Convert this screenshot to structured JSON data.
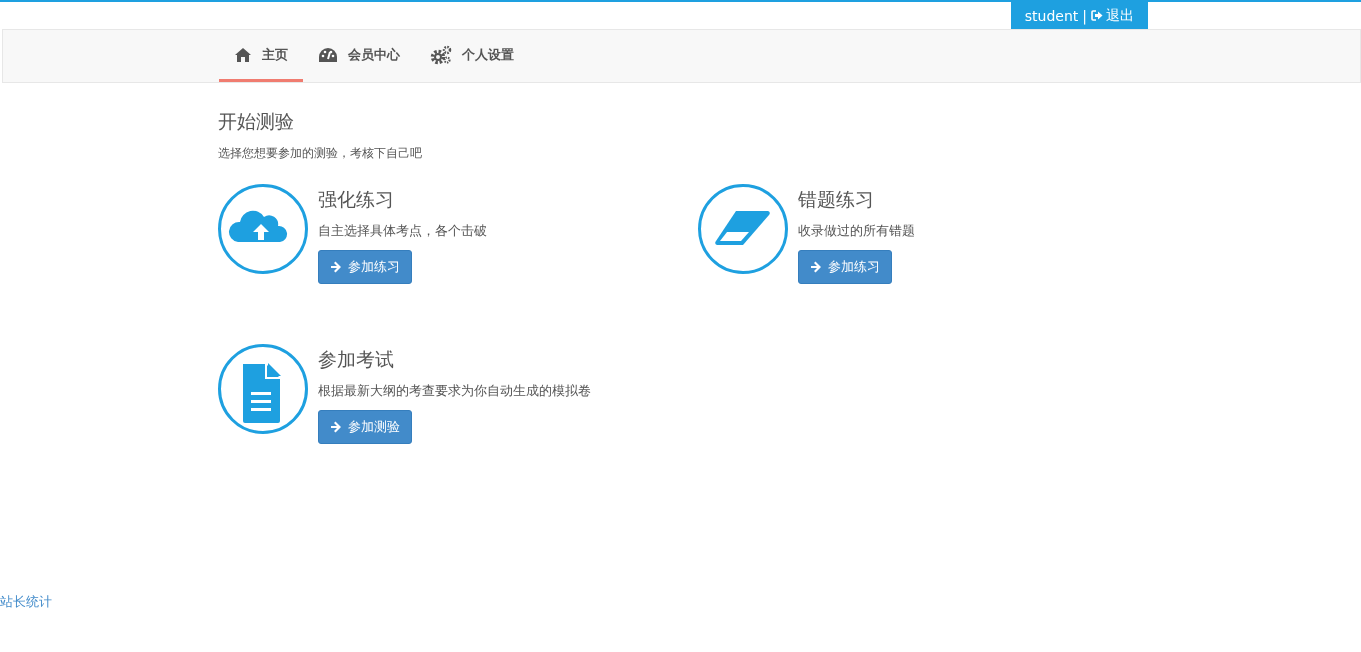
{
  "user_bar": {
    "username": "student",
    "separator": "|",
    "logout": "退出"
  },
  "nav": [
    {
      "label": "主页",
      "kind": "home",
      "selected": true
    },
    {
      "label": "会员中心",
      "kind": "dashboard",
      "selected": false
    },
    {
      "label": "个人设置",
      "kind": "gears",
      "selected": false
    }
  ],
  "heading": "开始测验",
  "subheading": "选择您想要参加的测验，考核下自己吧",
  "cards": [
    {
      "kind": "cloud",
      "title": "强化练习",
      "description": "自主选择具体考点，各个击破",
      "button": "参加练习"
    },
    {
      "kind": "eraser",
      "title": "错题练习",
      "description": "收录做过的所有错题",
      "button": "参加练习"
    },
    {
      "kind": "file",
      "title": "参加考试",
      "description": "根据最新大纲的考查要求为你自动生成的模拟卷",
      "button": "参加测验"
    }
  ],
  "footer_link": "站长统计"
}
